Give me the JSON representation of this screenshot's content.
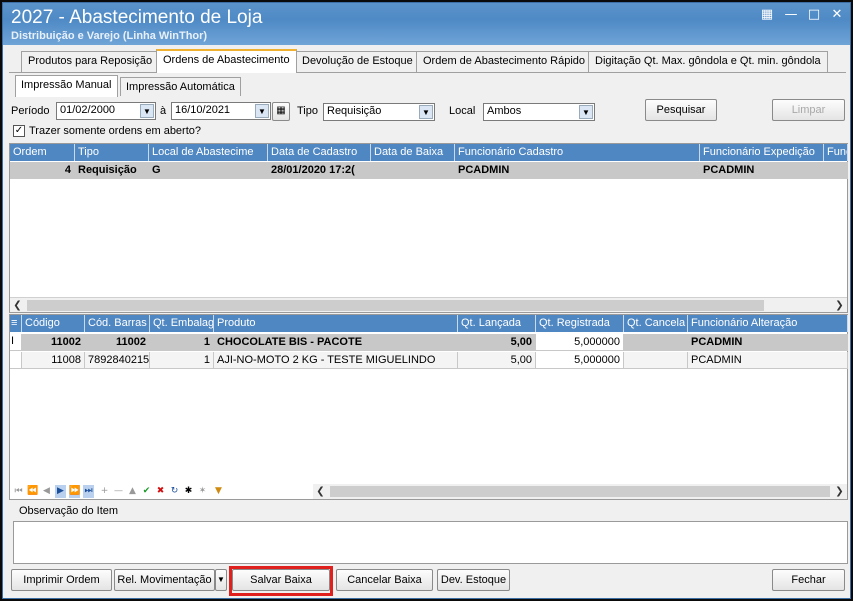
{
  "window": {
    "title": "2027 - Abastecimento de Loja",
    "subtitle": "Distribuição e Varejo (Linha WinThor)"
  },
  "tabs": [
    {
      "label": "Produtos para Reposição"
    },
    {
      "label": "Ordens de Abastecimento"
    },
    {
      "label": "Devolução de Estoque"
    },
    {
      "label": "Ordem de Abastecimento Rápido"
    },
    {
      "label": "Digitação Qt. Max. gôndola e Qt. min. gôndola"
    }
  ],
  "subtabs": [
    {
      "label": "Impressão Manual"
    },
    {
      "label": "Impressão Automática"
    }
  ],
  "filters": {
    "periodo_label": "Período",
    "date_from": "01/02/2000",
    "a_label": "à",
    "date_to": "16/10/2021",
    "tipo_label": "Tipo",
    "tipo_value": "Requisição",
    "local_label": "Local",
    "local_value": "Ambos",
    "pesquisar": "Pesquisar",
    "limpar": "Limpar",
    "checkbox_label": "Trazer somente ordens em aberto?",
    "checkbox_checked": true
  },
  "orders_grid": {
    "columns": [
      "Ordem",
      "Tipo",
      "Local de Abastecime",
      "Data de Cadastro",
      "Data de Baixa",
      "Funcionário Cadastro",
      "Funcionário Expedição",
      "Func"
    ],
    "rows": [
      {
        "ordem": "4",
        "tipo": "Requisição",
        "local": "G",
        "data_cadastro": "28/01/2020 17:2(",
        "data_baixa": "",
        "func_cadastro": "PCADMIN",
        "func_expedicao": "PCADMIN",
        "func": ""
      }
    ]
  },
  "items_grid": {
    "columns": [
      "Código",
      "Cód. Barras",
      "Qt. Embalag",
      "Produto",
      "Qt. Lançada",
      "Qt. Registrada",
      "Qt. Cancela",
      "Funcionário Alteração"
    ],
    "rows": [
      {
        "codigo": "11002",
        "cod_barras": "11002",
        "qt_embalagem": "1",
        "produto": "CHOCOLATE BIS - PACOTE",
        "qt_lancada": "5,00",
        "qt_registrada": "5,000000",
        "qt_cancelada": "",
        "func_alteracao": "PCADMIN"
      },
      {
        "codigo": "11008",
        "cod_barras": "7892840215",
        "qt_embalagem": "1",
        "produto": "AJI-NO-MOTO 2 KG - TESTE MIGUELINDO",
        "qt_lancada": "5,00",
        "qt_registrada": "5,000000",
        "qt_cancelada": "",
        "func_alteracao": "PCADMIN"
      }
    ]
  },
  "observacao_label": "Observação do Item",
  "buttons": {
    "imprimir": "Imprimir Ordem",
    "rel_mov": "Rel. Movimentação",
    "salvar": "Salvar Baixa",
    "cancelar": "Cancelar Baixa",
    "dev_estoque": "Dev. Estoque",
    "fechar": "Fechar"
  },
  "colors": {
    "grid_header": "#4f87c2",
    "selected_row": "#c8c8c8",
    "highlight": "#e0201c"
  }
}
